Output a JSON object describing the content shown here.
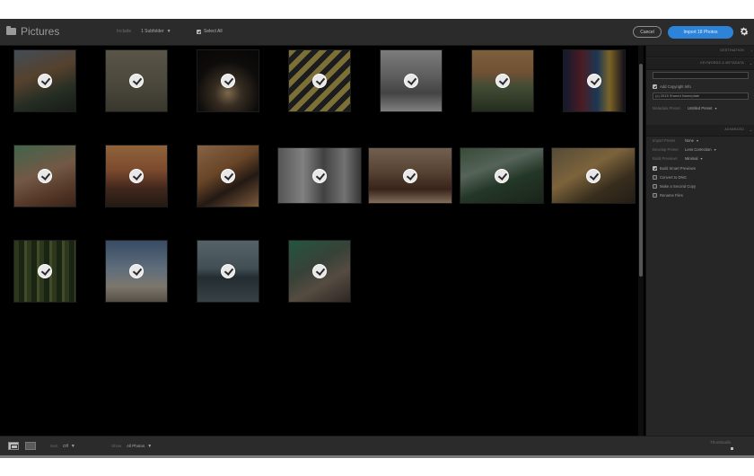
{
  "header": {
    "title": "Pictures",
    "include_label": "Include",
    "include_value": "1 Subfolder",
    "select_all_label": "Select All",
    "select_all_checked": true,
    "cancel_label": "Cancel",
    "import_label": "Import 18 Photos",
    "accent_color": "#2d83d9"
  },
  "panel": {
    "destination_header": "DESTINATION",
    "keywords_header": "KEYWORDS & METADATA",
    "add_copyright_label": "Add Copyright Info",
    "copyright_value": "(c) 2015 Shared Nameplate",
    "metadata_preset_label": "Metadata Preset",
    "metadata_preset_value": "Untitled Preset",
    "advanced_header": "ADVANCED",
    "import_preset_label": "Import Preset",
    "import_preset_value": "None",
    "develop_preset_label": "Develop Preset",
    "develop_preset_value": "Lens Correction",
    "build_previews_label": "Build Previews",
    "build_previews_value": "Minimal",
    "options": [
      {
        "label": "Build Smart Previews",
        "checked": true
      },
      {
        "label": "Convert to DNG",
        "checked": false
      },
      {
        "label": "Make a Second Copy",
        "checked": false
      },
      {
        "label": "Rename Files",
        "checked": false
      }
    ]
  },
  "footer": {
    "sort_label": "Sort",
    "sort_value": "Off",
    "show_label": "Show",
    "show_value": "All Photos",
    "thumbnails_label": "Thumbnails"
  },
  "photos": [
    {
      "desc": "street-scene",
      "checked": true
    },
    {
      "desc": "rocky-field",
      "checked": true
    },
    {
      "desc": "silhouette-night",
      "checked": true
    },
    {
      "desc": "striped-wall",
      "checked": true
    },
    {
      "desc": "group-photo",
      "checked": true
    },
    {
      "desc": "coastal-sunset",
      "checked": true
    },
    {
      "desc": "city-lights",
      "checked": true
    },
    {
      "desc": "portrait-green",
      "checked": true
    },
    {
      "desc": "beach-sunset",
      "checked": true
    },
    {
      "desc": "dog-on-bed",
      "checked": true
    },
    {
      "desc": "street-buildings",
      "checked": true
    },
    {
      "desc": "barrels",
      "checked": true
    },
    {
      "desc": "waterfall",
      "checked": true
    },
    {
      "desc": "dog-bed",
      "checked": true
    },
    {
      "desc": "forest",
      "checked": true
    },
    {
      "desc": "cloudy-sky",
      "checked": true
    },
    {
      "desc": "lake",
      "checked": true
    },
    {
      "desc": "street-sign",
      "checked": true
    }
  ]
}
